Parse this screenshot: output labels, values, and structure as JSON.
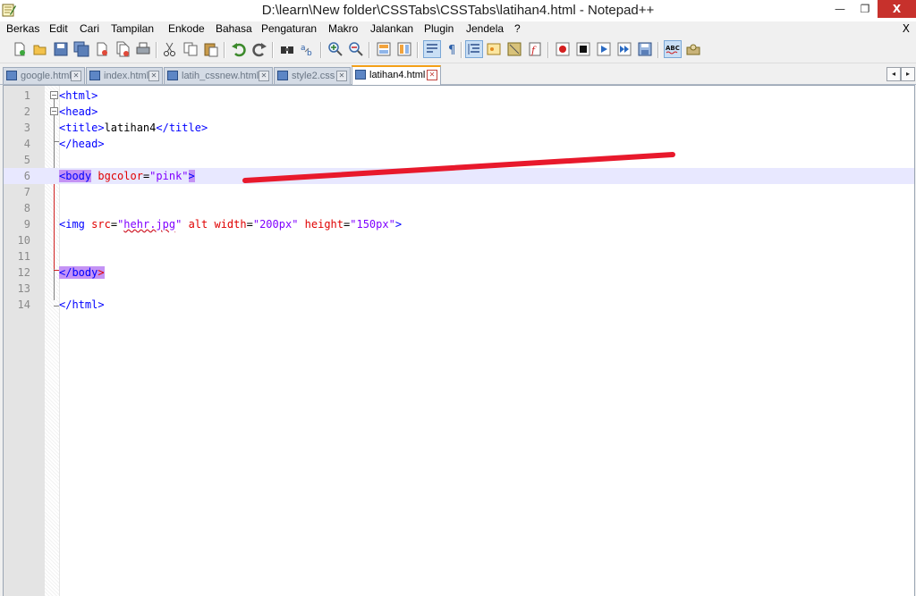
{
  "window": {
    "title": "D:\\learn\\New folder\\CSSTabs\\CSSTabs\\latihan4.html - Notepad++",
    "minimize": "—",
    "maximize": "❐",
    "close": "X"
  },
  "menu": {
    "items": [
      "Berkas",
      "Edit",
      "Cari",
      "Tampilan",
      "Enkode",
      "Bahasa",
      "Pengaturan",
      "Makro",
      "Jalankan",
      "Plugin",
      "Jendela",
      "?"
    ],
    "close_doc": "X"
  },
  "toolbar": {
    "icons": [
      "new-file-icon",
      "open-file-icon",
      "save-icon",
      "save-all-icon",
      "close-icon",
      "close-all-icon",
      "print-icon",
      "cut-icon",
      "copy-icon",
      "paste-icon",
      "undo-icon",
      "redo-icon",
      "find-icon",
      "replace-icon",
      "zoom-in-icon",
      "zoom-out-icon",
      "sync-vertical-icon",
      "sync-horizontal-icon",
      "word-wrap-icon",
      "show-all-chars-icon",
      "indent-guide-icon",
      "user-lang-icon",
      "doc-map-icon",
      "function-list-icon",
      "macro-record-icon",
      "macro-stop-icon",
      "macro-play-icon",
      "macro-run-multiple-icon",
      "macro-save-icon",
      "spellcheck-icon",
      "plugin-icon"
    ]
  },
  "tabs": [
    {
      "label": "google.html",
      "active": false
    },
    {
      "label": "index.html",
      "active": false
    },
    {
      "label": "latih_cssnew.html",
      "active": false
    },
    {
      "label": "style2.css",
      "active": false
    },
    {
      "label": "latihan4.html",
      "active": true
    }
  ],
  "tab_scroll": {
    "left": "◂",
    "right": "▸"
  },
  "editor": {
    "lines": [
      {
        "n": "1"
      },
      {
        "n": "2"
      },
      {
        "n": "3"
      },
      {
        "n": "4"
      },
      {
        "n": "5"
      },
      {
        "n": "6"
      },
      {
        "n": "7"
      },
      {
        "n": "8"
      },
      {
        "n": "9"
      },
      {
        "n": "10"
      },
      {
        "n": "11"
      },
      {
        "n": "12"
      },
      {
        "n": "13"
      },
      {
        "n": "14"
      }
    ],
    "code": {
      "l1": "<html>",
      "l2": "<head>",
      "l3_open": "<title>",
      "l3_text": "latihan4",
      "l3_close": "</title>",
      "l4": "</head>",
      "l6_open": "<body",
      "l6_attr": "bgcolor",
      "l6_eq": "=",
      "l6_val": "\"pink\"",
      "l6_close": ">",
      "l9_open": "<img",
      "l9_attr1": "src",
      "l9_eq1": "=",
      "l9_val1_q1": "\"",
      "l9_val1": "hehr.jpg",
      "l9_val1_q2": "\"",
      "l9_attr2": "alt",
      "l9_attr3": "width",
      "l9_eq3": "=",
      "l9_val3": "\"200px\"",
      "l9_attr4": "height",
      "l9_eq4": "=",
      "l9_val4": "\"150px\"",
      "l9_close": ">",
      "l12_open": "</body",
      "l12_close": ">",
      "l14": "</html>"
    },
    "current_line": "6"
  },
  "colors": {
    "tag": "#0000ff",
    "attribute": "#e00000",
    "value": "#8000ff",
    "tag_match_highlight": "#c493f5",
    "current_line_bg": "#e8e8ff",
    "annotation_stroke": "#e8192c"
  }
}
